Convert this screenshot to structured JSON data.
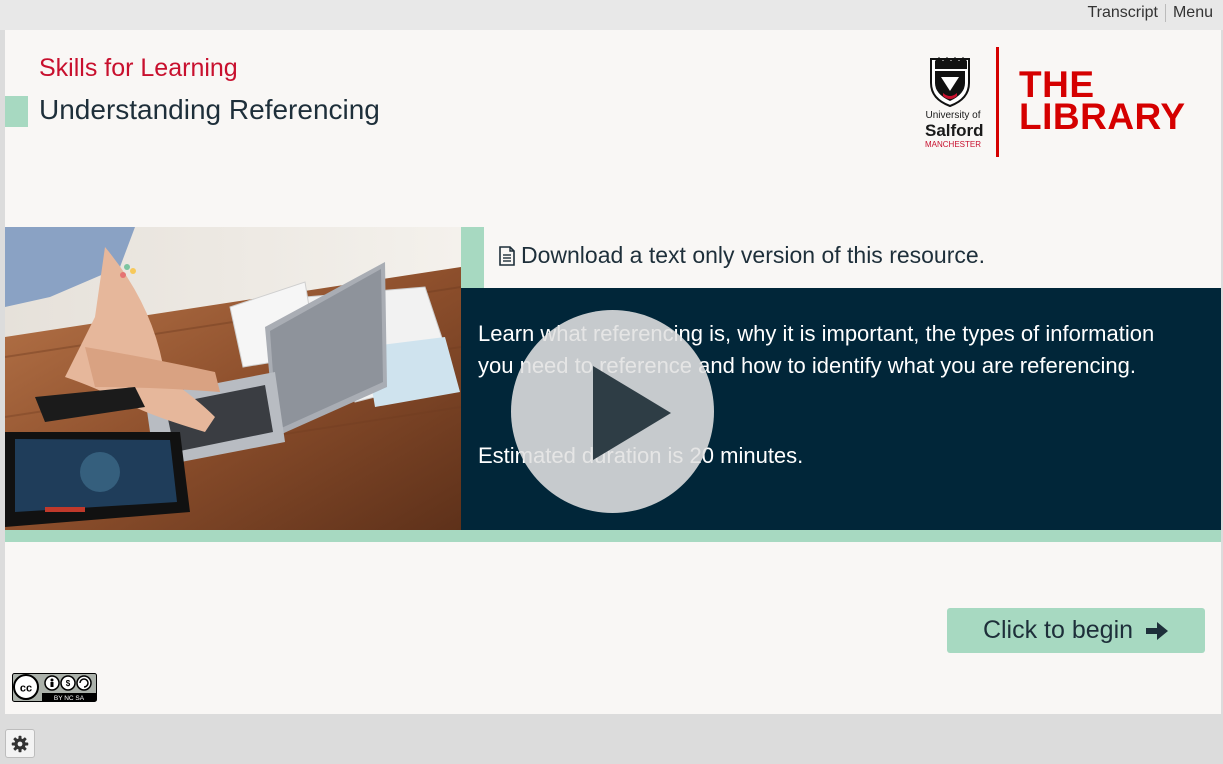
{
  "topnav": {
    "transcript": "Transcript",
    "menu": "Menu"
  },
  "header": {
    "subtitle": "Skills for Learning",
    "title": "Understanding Referencing"
  },
  "logo": {
    "university_line1": "University of",
    "university_line2": "Salford",
    "university_line3": "MANCHESTER",
    "library_line1": "THE",
    "library_line2": "LIBRARY"
  },
  "download": {
    "icon": "document-icon",
    "label": "Download a text only version of this resource."
  },
  "description": {
    "text": "Learn what referencing is, why it is important, the types of information you need to reference and how to identify what you are referencing.",
    "duration": "Estimated duration is 20 minutes."
  },
  "cta": {
    "label": "Click to begin",
    "icon": "arrow-right-icon"
  },
  "license": {
    "icon": "cc-by-nc-sa-icon",
    "label": "BY NC SA"
  },
  "settings": {
    "icon": "gear-icon"
  },
  "colors": {
    "accent_green": "#a7d9c1",
    "brand_red": "#d50000",
    "panel_navy": "#012639",
    "subtitle_red": "#c8102e"
  }
}
